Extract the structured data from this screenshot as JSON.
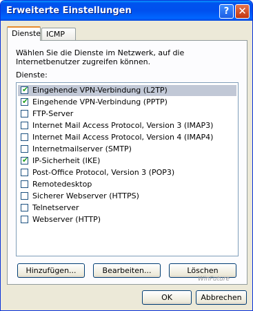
{
  "window": {
    "title": "Erweiterte Einstellungen",
    "help": "?",
    "close": "✕"
  },
  "tabs": [
    {
      "label": "Dienste"
    },
    {
      "label": "ICMP"
    }
  ],
  "description": "Wählen Sie die Dienste im Netzwerk, auf die Internetbenutzer zugreifen können.",
  "list_label": "Dienste:",
  "services": [
    {
      "label": "Eingehende VPN-Verbindung (L2TP)",
      "checked": true,
      "selected": true
    },
    {
      "label": "Eingehende VPN-Verbindung (PPTP)",
      "checked": true,
      "selected": false
    },
    {
      "label": "FTP-Server",
      "checked": false,
      "selected": false
    },
    {
      "label": "Internet Mail Access Protocol, Version 3 (IMAP3)",
      "checked": false,
      "selected": false
    },
    {
      "label": "Internet Mail Access Protocol, Version 4 (IMAP4)",
      "checked": false,
      "selected": false
    },
    {
      "label": "Internetmailserver (SMTP)",
      "checked": false,
      "selected": false
    },
    {
      "label": "IP-Sicherheit (IKE)",
      "checked": true,
      "selected": false
    },
    {
      "label": "Post-Office Protocol, Version 3 (POP3)",
      "checked": false,
      "selected": false
    },
    {
      "label": "Remotedesktop",
      "checked": false,
      "selected": false
    },
    {
      "label": "Sicherer Webserver (HTTPS)",
      "checked": false,
      "selected": false
    },
    {
      "label": "Telnetserver",
      "checked": false,
      "selected": false
    },
    {
      "label": "Webserver (HTTP)",
      "checked": false,
      "selected": false
    }
  ],
  "buttons": {
    "add": "Hinzufügen...",
    "edit": "Bearbeiten...",
    "delete": "Löschen",
    "ok": "OK",
    "cancel": "Abbrechen"
  },
  "watermark": "WinFuture",
  "colors": {
    "titlebar": "#0055e5",
    "selection": "#c1c8d6",
    "check": "#21a121",
    "tab_accent": "#e68b2c"
  }
}
